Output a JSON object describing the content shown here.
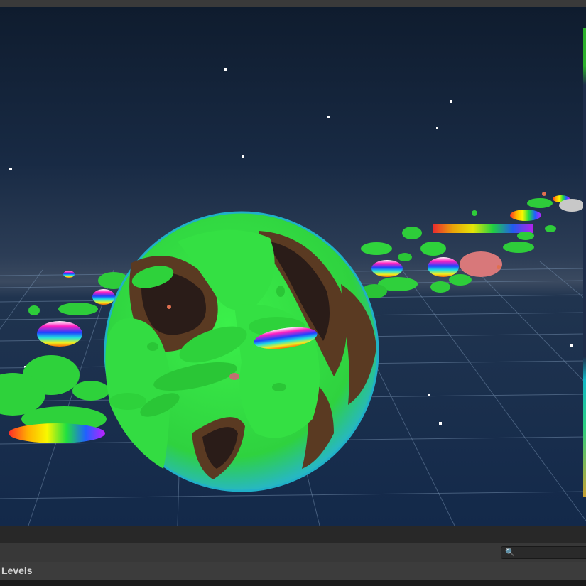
{
  "search": {
    "icon": "search-icon",
    "value": ""
  },
  "hierarchy": {
    "root_label": "Levels"
  },
  "colors": {
    "grass": "#2ee23a",
    "dirt": "#5a3a22",
    "sky_top": "#0f1c2e",
    "grid": "#6e86a6",
    "panel": "#383838"
  }
}
